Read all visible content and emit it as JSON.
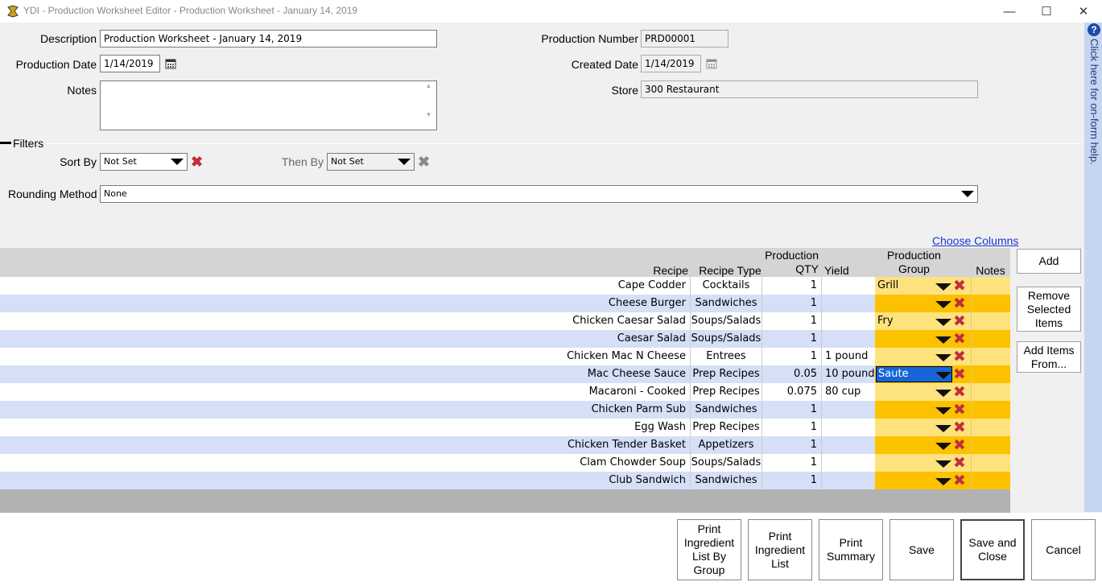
{
  "window": {
    "title": "YDI - Production Worksheet Editor - Production Worksheet - January 14, 2019",
    "minimize": "—",
    "maximize": "☐",
    "close": "✕"
  },
  "form": {
    "description_label": "Description",
    "description_value": "Production Worksheet - January 14, 2019",
    "production_date_label": "Production Date",
    "production_date_value": "1/14/2019",
    "notes_label": "Notes",
    "notes_value": "",
    "production_number_label": "Production Number",
    "production_number_value": "PRD00001",
    "created_date_label": "Created Date",
    "created_date_value": "1/14/2019",
    "store_label": "Store",
    "store_value": "300 Restaurant"
  },
  "filters": {
    "section_label": "Filters",
    "sort_by_label": "Sort By",
    "sort_by_value": "Not Set",
    "then_by_label": "Then By",
    "then_by_value": "Not Set",
    "rounding_label": "Rounding Method",
    "rounding_value": "None"
  },
  "help": {
    "icon": "?",
    "text": "Click here for on-form help."
  },
  "grid": {
    "choose_columns": "Choose Columns",
    "headers": {
      "recipe": "Recipe",
      "recipe_type": "Recipe Type",
      "production_qty_1": "Production",
      "production_qty_2": "QTY",
      "yield": "Yield",
      "group_1": "Production",
      "group_2": "Group",
      "notes": "Notes"
    },
    "rows": [
      {
        "recipe": "Cape Codder",
        "type": "Cocktails",
        "qty": "1",
        "yield": "",
        "group": "Grill"
      },
      {
        "recipe": "Cheese Burger",
        "type": "Sandwiches",
        "qty": "1",
        "yield": "",
        "group": ""
      },
      {
        "recipe": "Chicken Caesar Salad",
        "type": "Soups/Salads",
        "qty": "1",
        "yield": "",
        "group": "Fry"
      },
      {
        "recipe": "Caesar Salad",
        "type": "Soups/Salads",
        "qty": "1",
        "yield": "",
        "group": ""
      },
      {
        "recipe": "Chicken Mac N Cheese",
        "type": "Entrees",
        "qty": "1",
        "yield": "1 pound",
        "group": ""
      },
      {
        "recipe": "Mac Cheese Sauce",
        "type": "Prep Recipes",
        "qty": "0.05",
        "yield": "10 pound",
        "group": "Saute"
      },
      {
        "recipe": "Macaroni - Cooked",
        "type": "Prep Recipes",
        "qty": "0.075",
        "yield": "80 cup",
        "group": ""
      },
      {
        "recipe": "Chicken Parm Sub",
        "type": "Sandwiches",
        "qty": "1",
        "yield": "",
        "group": ""
      },
      {
        "recipe": "Egg Wash",
        "type": "Prep Recipes",
        "qty": "1",
        "yield": "",
        "group": ""
      },
      {
        "recipe": "Chicken Tender Basket",
        "type": "Appetizers",
        "qty": "1",
        "yield": "",
        "group": ""
      },
      {
        "recipe": "Clam Chowder Soup",
        "type": "Soups/Salads",
        "qty": "1",
        "yield": "",
        "group": ""
      },
      {
        "recipe": "Club Sandwich",
        "type": "Sandwiches",
        "qty": "1",
        "yield": "",
        "group": ""
      }
    ]
  },
  "side_buttons": {
    "add": "Add",
    "remove_1": "Remove",
    "remove_2": "Selected",
    "remove_3": "Items",
    "add_from_1": "Add Items",
    "add_from_2": "From..."
  },
  "bottom_buttons": {
    "print_group": [
      "Print",
      "Ingredient",
      "List By",
      "Group"
    ],
    "print_list": [
      "Print",
      "Ingredient",
      "List"
    ],
    "print_summary": [
      "Print",
      "Summary"
    ],
    "save": "Save",
    "save_close": [
      "Save and",
      "Close"
    ],
    "cancel": "Cancel"
  },
  "colors": {
    "grid_row_alt": "#d5dff7",
    "group_cell_light": "#fde27e",
    "group_cell_dark": "#fcc200",
    "delete_x": "#c0303a",
    "selection_blue": "#1665d8",
    "help_strip": "#c6d5f2"
  },
  "icons": [
    "app-logo-icon",
    "calendar-icon",
    "dropdown-caret-icon",
    "clear-x-icon",
    "help-question-icon"
  ]
}
